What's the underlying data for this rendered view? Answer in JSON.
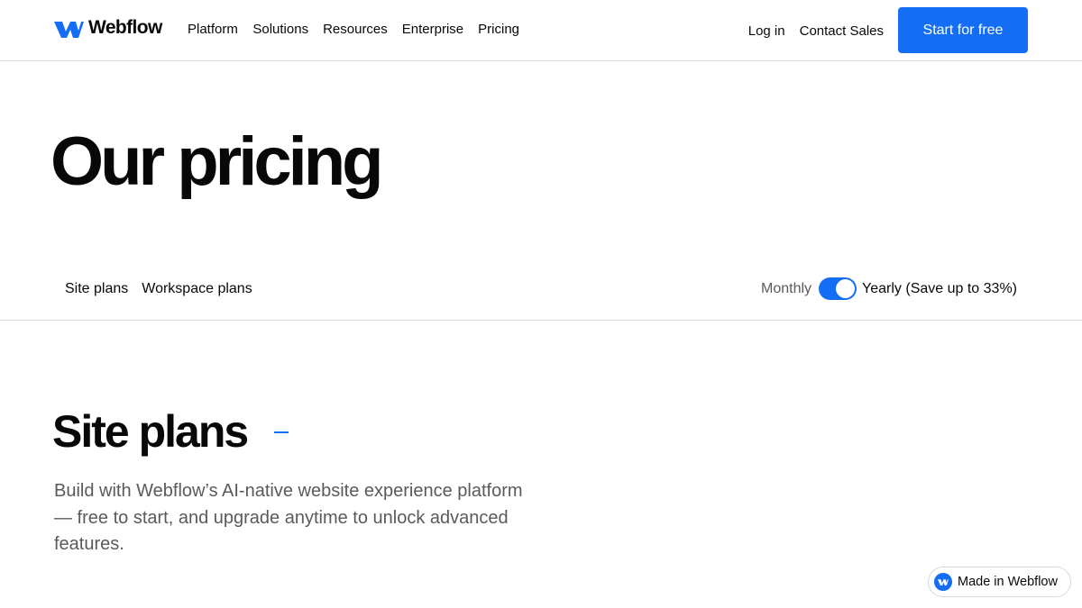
{
  "header": {
    "logo_text": "Webflow",
    "nav": [
      "Platform",
      "Solutions",
      "Resources",
      "Enterprise",
      "Pricing"
    ],
    "login": "Log in",
    "contact": "Contact Sales",
    "cta": "Start for free"
  },
  "hero": {
    "title": "Our pricing"
  },
  "plan_tabs": [
    "Site plans",
    "Workspace plans"
  ],
  "billing": {
    "monthly": "Monthly",
    "yearly": "Yearly (Save up to 33%)",
    "yearly_selected": true
  },
  "section": {
    "title": "Site plans",
    "description": "Build with Webflow’s AI-native website experience platform — free to start, and upgrade anytime to unlock advanced features."
  },
  "badge": {
    "text": "Made in Webflow"
  },
  "colors": {
    "accent": "#146ef5",
    "text": "#080808",
    "muted": "#5a5a5a",
    "border": "#d8d8d8"
  },
  "icons": {
    "logo": "webflow-logo-icon",
    "badge": "webflow-badge-icon"
  }
}
